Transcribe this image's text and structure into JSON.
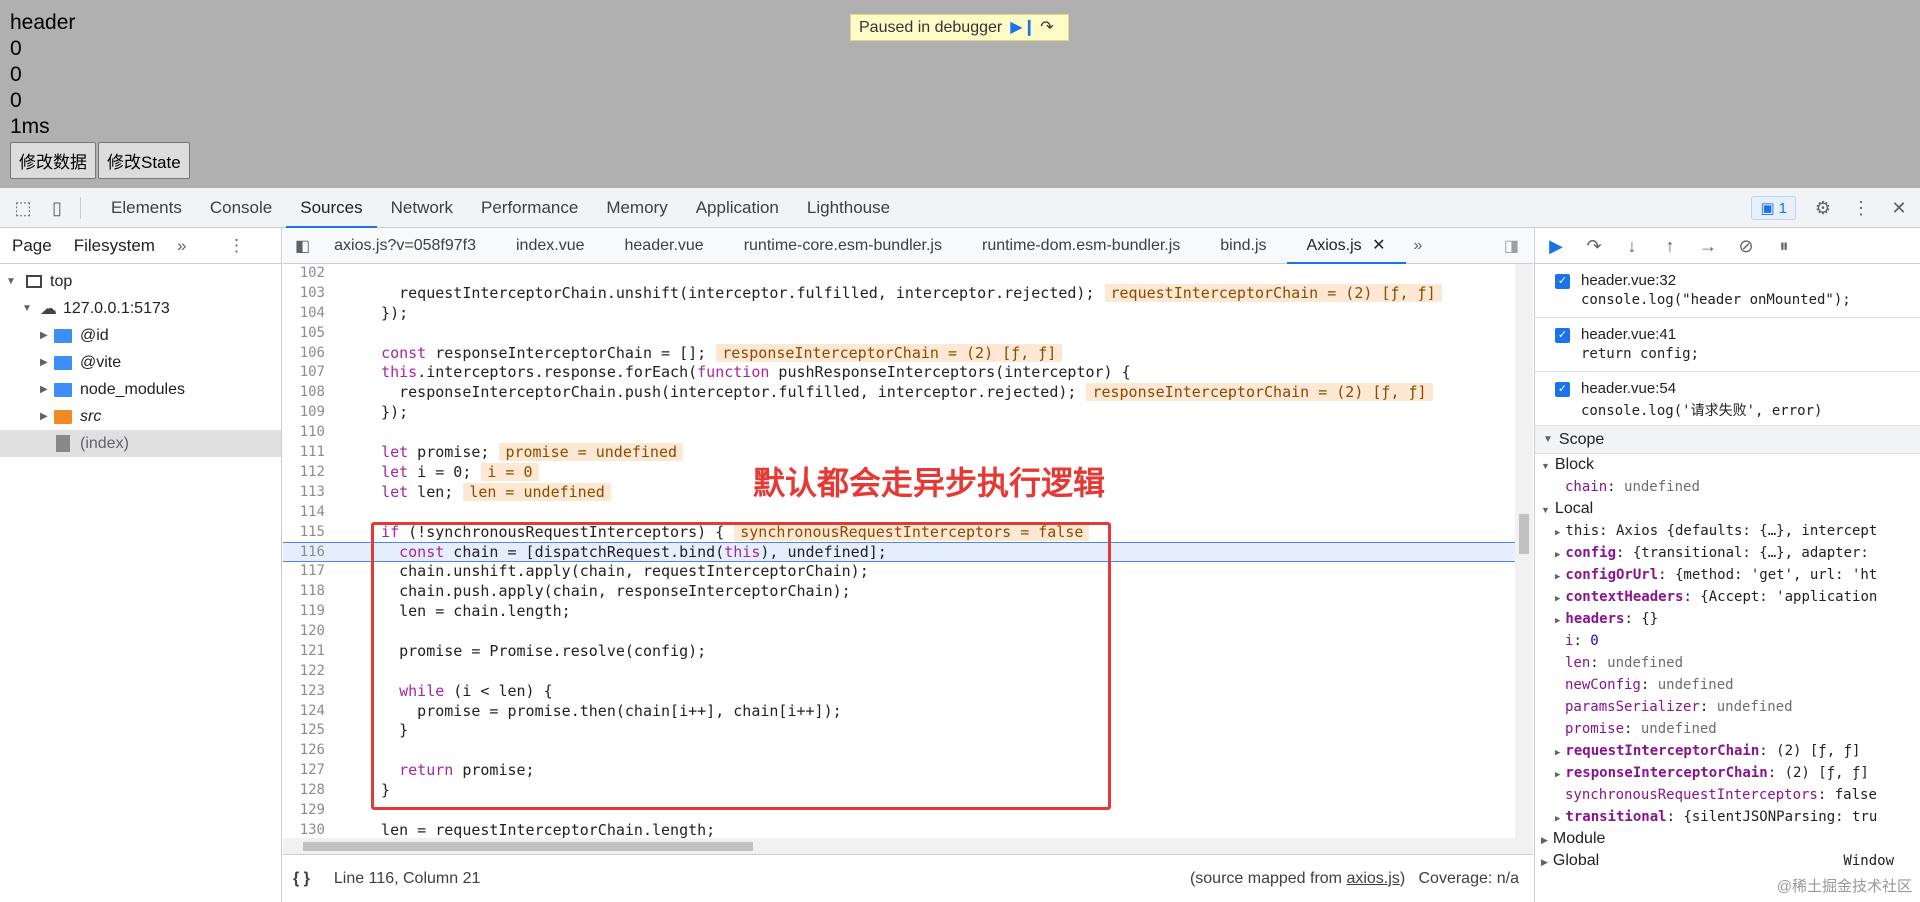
{
  "page": {
    "lines": [
      "header",
      "0",
      "0",
      "0",
      "1ms"
    ],
    "buttons": [
      "修改数据",
      "修改State"
    ]
  },
  "debugger_banner": "Paused in debugger",
  "devtools": {
    "tabs": [
      "Elements",
      "Console",
      "Sources",
      "Network",
      "Performance",
      "Memory",
      "Application",
      "Lighthouse"
    ],
    "issues_count": "1",
    "navigator": {
      "tabs": [
        "Page",
        "Filesystem"
      ],
      "tree": [
        {
          "label": "top",
          "level": 0
        },
        {
          "label": "127.0.0.1:5173",
          "level": 1
        },
        {
          "label": "@id",
          "level": 2
        },
        {
          "label": "@vite",
          "level": 2
        },
        {
          "label": "node_modules",
          "level": 2
        },
        {
          "label": "src",
          "level": 2
        },
        {
          "label": "(index)",
          "level": 2
        }
      ]
    },
    "file_tabs": [
      "axios.js?v=058f97f3",
      "index.vue",
      "header.vue",
      "runtime-core.esm-bundler.js",
      "runtime-dom.esm-bundler.js",
      "bind.js",
      "Axios.js"
    ],
    "code": [
      {
        "n": "102",
        "t": ""
      },
      {
        "n": "103",
        "t": "    requestInterceptorChain.unshift(interceptor.fulfilled, interceptor.rejected);",
        "i": "requestInterceptorChain = (2) [ƒ, ƒ]"
      },
      {
        "n": "104",
        "t": "  });"
      },
      {
        "n": "105",
        "t": ""
      },
      {
        "n": "106",
        "t": "  const responseInterceptorChain = [];",
        "i": "responseInterceptorChain = (2) [ƒ, ƒ]"
      },
      {
        "n": "107",
        "t": "  this.interceptors.response.forEach(function pushResponseInterceptors(interceptor) {"
      },
      {
        "n": "108",
        "t": "    responseInterceptorChain.push(interceptor.fulfilled, interceptor.rejected);",
        "i": "responseInterceptorChain = (2) [ƒ, ƒ]"
      },
      {
        "n": "109",
        "t": "  });"
      },
      {
        "n": "110",
        "t": ""
      },
      {
        "n": "111",
        "t": "  let promise;",
        "i": "promise = undefined"
      },
      {
        "n": "112",
        "t": "  let i = 0;",
        "i": "i = 0"
      },
      {
        "n": "113",
        "t": "  let len;",
        "i": "len = undefined"
      },
      {
        "n": "114",
        "t": ""
      },
      {
        "n": "115",
        "t": "  if (!synchronousRequestInterceptors) {",
        "i": "synchronousRequestInterceptors = false"
      },
      {
        "n": "116",
        "t": "    const chain = [dispatchRequest.bind(this), undefined];",
        "cur": true
      },
      {
        "n": "117",
        "t": "    chain.unshift.apply(chain, requestInterceptorChain);"
      },
      {
        "n": "118",
        "t": "    chain.push.apply(chain, responseInterceptorChain);"
      },
      {
        "n": "119",
        "t": "    len = chain.length;"
      },
      {
        "n": "120",
        "t": ""
      },
      {
        "n": "121",
        "t": "    promise = Promise.resolve(config);"
      },
      {
        "n": "122",
        "t": ""
      },
      {
        "n": "123",
        "t": "    while (i < len) {"
      },
      {
        "n": "124",
        "t": "      promise = promise.then(chain[i++], chain[i++]);"
      },
      {
        "n": "125",
        "t": "    }"
      },
      {
        "n": "126",
        "t": ""
      },
      {
        "n": "127",
        "t": "    return promise;"
      },
      {
        "n": "128",
        "t": "  }"
      },
      {
        "n": "129",
        "t": ""
      },
      {
        "n": "130",
        "t": "  len = requestInterceptorChain.length;"
      }
    ],
    "annotation": "默认都会走异步执行逻辑",
    "status": {
      "position": "Line 116, Column 21",
      "source_mapped_prefix": "(source mapped from ",
      "source_mapped_file": "axios.js",
      "source_mapped_suffix": ")",
      "coverage": "Coverage: n/a"
    },
    "breakpoints": [
      {
        "file": "header.vue:32",
        "code": "console.log(\"header onMounted\");"
      },
      {
        "file": "header.vue:41",
        "code": "return config;"
      },
      {
        "file": "header.vue:54",
        "code": "console.log('请求失败', error)"
      }
    ],
    "scope": {
      "title": "Scope",
      "block": "Block",
      "block_items": [
        {
          "k": "chain",
          "v": "undefined"
        }
      ],
      "local": "Local",
      "local_items": [
        {
          "k": "this",
          "v": "Axios {defaults: {…}, intercept",
          "exp": true,
          "plain": true
        },
        {
          "k": "config",
          "v": "{transitional: {…}, adapter:",
          "exp": true
        },
        {
          "k": "configOrUrl",
          "v": "{method: 'get', url: 'ht",
          "exp": true
        },
        {
          "k": "contextHeaders",
          "v": "{Accept: 'application",
          "exp": true
        },
        {
          "k": "headers",
          "v": "{}",
          "exp": true
        },
        {
          "k": "i",
          "v": "0"
        },
        {
          "k": "len",
          "v": "undefined"
        },
        {
          "k": "newConfig",
          "v": "undefined"
        },
        {
          "k": "paramsSerializer",
          "v": "undefined"
        },
        {
          "k": "promise",
          "v": "undefined"
        },
        {
          "k": "requestInterceptorChain",
          "v": "(2) [ƒ, ƒ]",
          "exp": true
        },
        {
          "k": "responseInterceptorChain",
          "v": "(2) [ƒ, ƒ]",
          "exp": true
        },
        {
          "k": "synchronousRequestInterceptors",
          "v": "false"
        },
        {
          "k": "transitional",
          "v": "{silentJSONParsing: tru",
          "exp": true
        }
      ],
      "module": "Module",
      "global": "Global",
      "global_value": "Window"
    },
    "watermark": "@稀土掘金技术社区"
  }
}
